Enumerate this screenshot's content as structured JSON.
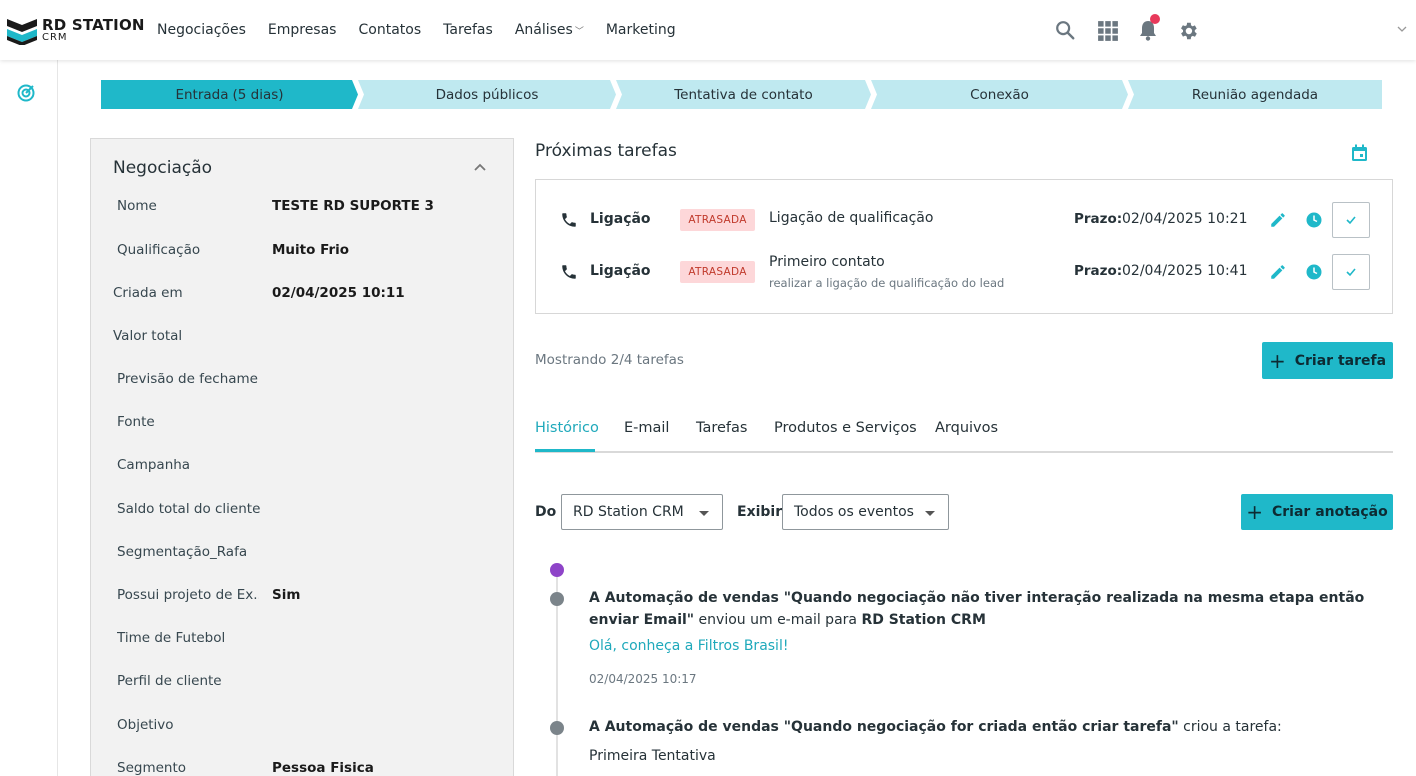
{
  "brand": {
    "name_line1": "RD STATION",
    "name_line2": "CRM"
  },
  "nav": {
    "items": [
      "Negociações",
      "Empresas",
      "Contatos",
      "Tarefas",
      "Análises",
      "Marketing"
    ],
    "has_dropdown": "Análises",
    "icons": [
      "search-icon",
      "apps-grid-icon",
      "bell-icon",
      "gear-icon",
      "chevron-down-icon"
    ]
  },
  "colors": {
    "accent": "#1fb8c9",
    "stage_inactive": "#bfe9f0",
    "overdue_bg": "#fdd7d9",
    "overdue_text": "#c0392b",
    "timeline_purple": "#8e44c8",
    "timeline_gray": "#7b848a",
    "notification": "#e8395b"
  },
  "pipeline": {
    "stages": [
      {
        "label": "Entrada",
        "extra": "(5 dias)",
        "active": true
      },
      {
        "label": "Dados públicos"
      },
      {
        "label": "Tentativa de contato"
      },
      {
        "label": "Conexão"
      },
      {
        "label": "Reunião agendada"
      }
    ]
  },
  "deal": {
    "title": "Negociação",
    "fields": [
      {
        "label": "Nome",
        "value": "TESTE RD SUPORTE 3"
      },
      {
        "label": "Qualificação",
        "value": "Muito Frio"
      },
      {
        "label": "Criada em",
        "value": "02/04/2025 10:11"
      },
      {
        "label": "Valor total",
        "value": ""
      },
      {
        "label": "Previsão de fechame...",
        "value": ""
      },
      {
        "label": "Fonte",
        "value": ""
      },
      {
        "label": "Campanha",
        "value": ""
      },
      {
        "label": "Saldo total do cliente",
        "value": ""
      },
      {
        "label": "Segmentação_Rafa",
        "value": ""
      },
      {
        "label": "Possui projeto de Ex...",
        "value": "Sim"
      },
      {
        "label": "Time de Futebol",
        "value": ""
      },
      {
        "label": "Perfil de cliente",
        "value": ""
      },
      {
        "label": "Objetivo",
        "value": ""
      },
      {
        "label": "Segmento",
        "value": "Pessoa Fisica"
      }
    ]
  },
  "tasks": {
    "title": "Próximas tarefas",
    "items": [
      {
        "type": "Ligação",
        "status": "ATRASADA",
        "title": "Ligação de qualificação",
        "subtitle": "",
        "due_label": "Prazo:",
        "due": "02/04/2025 10:21"
      },
      {
        "type": "Ligação",
        "status": "ATRASADA",
        "title": "Primeiro contato",
        "subtitle": "realizar a ligação de qualificação do lead",
        "due_label": "Prazo:",
        "due": "02/04/2025 10:41"
      }
    ],
    "showing": "Mostrando 2/4 tarefas",
    "create_button": "Criar tarefa"
  },
  "tabs": {
    "items": [
      "Histórico",
      "E-mail",
      "Tarefas",
      "Produtos e Serviços",
      "Arquivos"
    ],
    "active": "Histórico"
  },
  "filters": {
    "from_label": "Do",
    "from_value": "RD Station CRM",
    "show_label": "Exibir",
    "show_value": "Todos os eventos",
    "create_note_button": "Criar anotação"
  },
  "history": [
    {
      "pre": "A Automação de vendas \"Quando negociação não tiver interação realizada na mesma etapa então enviar Email\"",
      "mid": " enviou um e-mail para ",
      "bold_end": "RD Station CRM",
      "link": "Olá, conheça a Filtros Brasil!",
      "date": "02/04/2025 10:17"
    },
    {
      "pre": "A Automação de vendas \"Quando negociação for criada então criar tarefa\"",
      "mid": " criou a tarefa:",
      "detail": "Primeira Tentativa"
    }
  ]
}
